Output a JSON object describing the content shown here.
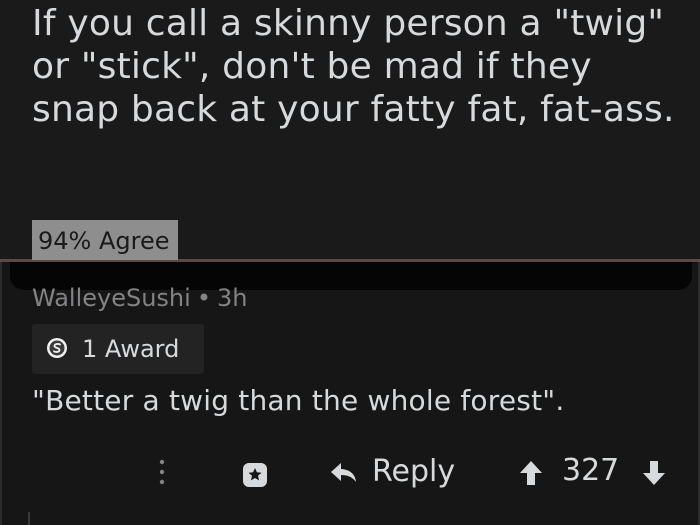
{
  "post": {
    "title": "If you call a skinny person a \"twig\" or \"stick\", don't be mad if they snap back at your fatty fat, fat-ass.",
    "agree_badge": "94% Agree"
  },
  "comment": {
    "author": "WalleyeSushi",
    "separator": "•",
    "age": "3h",
    "award_label": "1 Award",
    "body": "\"Better a twig than the whole forest\"."
  },
  "actions": {
    "more_icon": "more-vertical-icon",
    "award_icon": "award-icon",
    "reply_icon": "reply-arrow-icon",
    "reply_label": "Reply",
    "upvote_icon": "upvote-arrow-icon",
    "score": "327",
    "downvote_icon": "downvote-arrow-icon"
  },
  "colors": {
    "background": "#161616",
    "text": "#d7dadc",
    "muted": "#818384",
    "badge": "#8e8e8e"
  }
}
